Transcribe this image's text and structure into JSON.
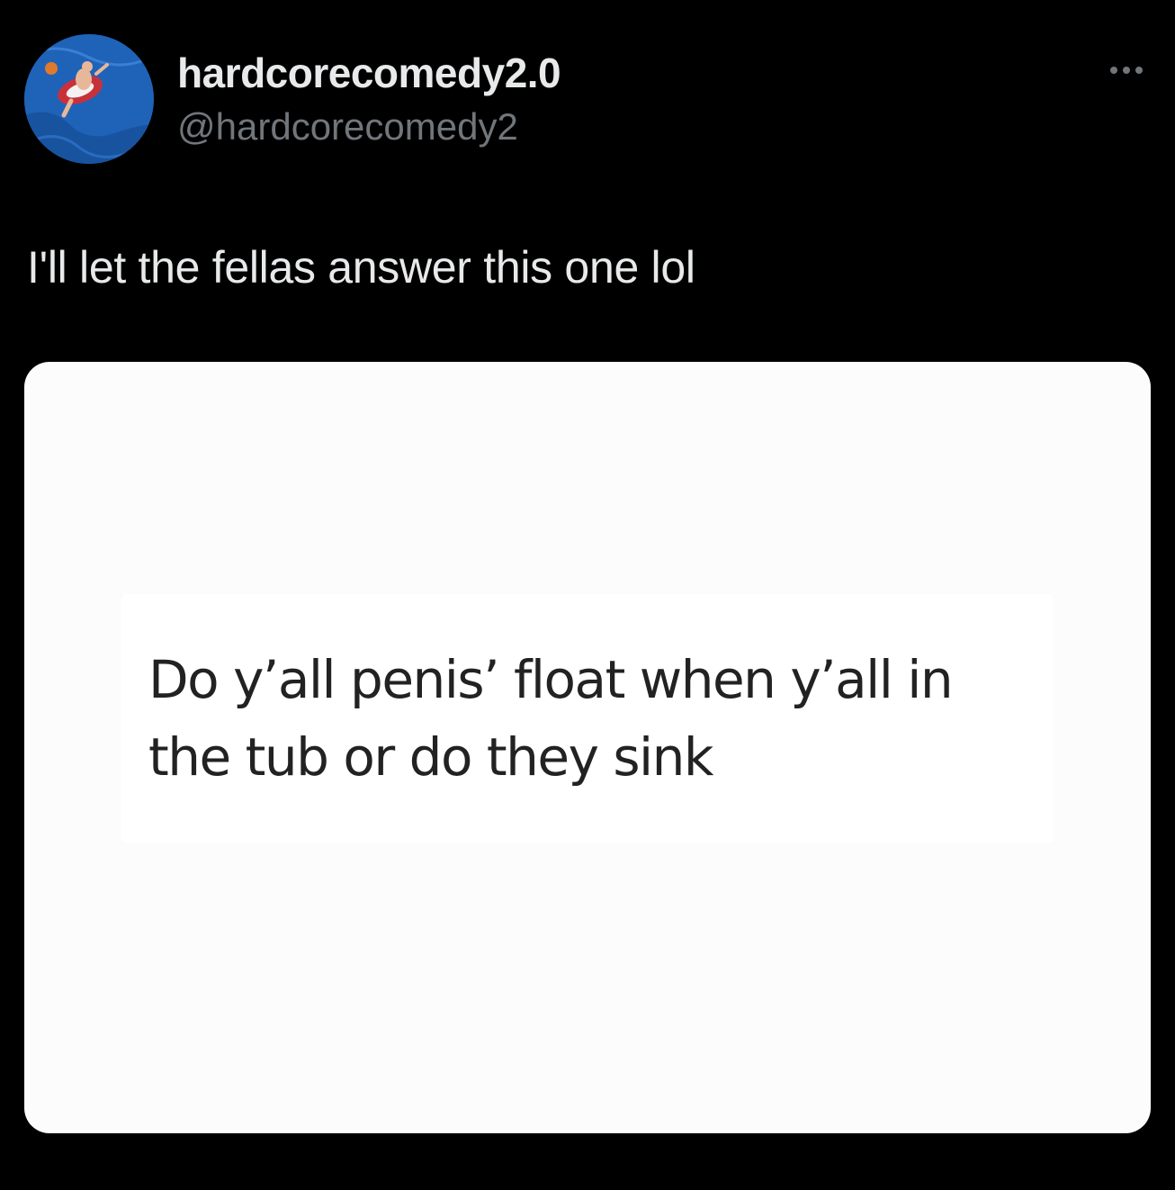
{
  "author": {
    "display_name": "hardcorecomedy2.0",
    "handle": "@hardcorecomedy2",
    "avatar_icon": "profile-photo-pool-float"
  },
  "more_icon": "more-options-icon",
  "tweet": {
    "text": "I'll let the fellas answer this one lol"
  },
  "media": {
    "quote_text": "Do y’all penis’ float when y’all in the tub or do they sink"
  },
  "colors": {
    "background": "#000000",
    "primary_text": "#e7e9ea",
    "secondary_text": "#71767b",
    "card_background": "#fcfcfc"
  }
}
